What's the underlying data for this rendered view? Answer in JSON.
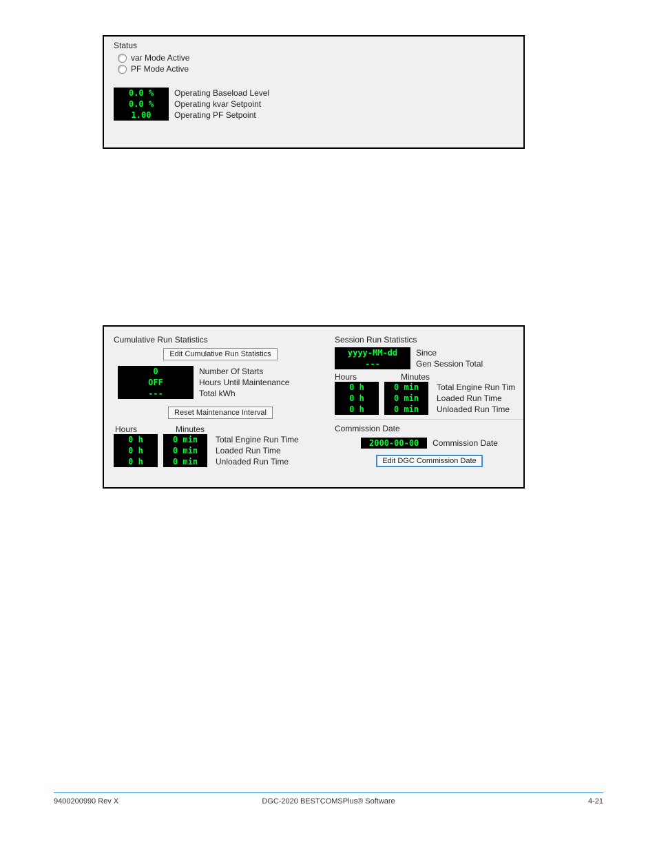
{
  "panel1": {
    "title": "Status",
    "radios": [
      {
        "label": "var Mode Active"
      },
      {
        "label": "PF Mode Active"
      }
    ],
    "readings": [
      {
        "value": "0.0 %",
        "label": "Operating Baseload Level"
      },
      {
        "value": "0.0 %",
        "label": "Operating kvar Setpoint"
      },
      {
        "value": "1.00",
        "label": "Operating PF Setpoint"
      }
    ]
  },
  "panel2": {
    "left": {
      "title": "Cumulative Run Statistics",
      "edit_btn": "Edit Cumulative Run Statistics",
      "stats": [
        {
          "value": "0",
          "label": "Number Of Starts"
        },
        {
          "value": "OFF",
          "label": "Hours Until Maintenance"
        },
        {
          "value": "---",
          "label": "Total kWh"
        }
      ],
      "reset_btn": "Reset Maintenance Interval",
      "hours_hdr": "Hours",
      "minutes_hdr": "Minutes",
      "runs": {
        "hours": [
          "0 h",
          "0 h",
          "0 h"
        ],
        "minutes": [
          "0 min",
          "0 min",
          "0 min"
        ],
        "labels": [
          "Total Engine Run Time",
          "Loaded Run Time",
          "Unloaded Run Time"
        ]
      }
    },
    "right": {
      "title": "Session Run Statistics",
      "since_value": "yyyy-MM-dd",
      "since_label": "Since",
      "dash_value": "---",
      "gen_label": "Gen Session Total",
      "hours_hdr": "Hours",
      "minutes_hdr": "Minutes",
      "runs": {
        "hours": [
          "0 h",
          "0 h",
          "0 h"
        ],
        "minutes": [
          "0 min",
          "0 min",
          "0 min"
        ],
        "labels": [
          "Total Engine Run Tim",
          "Loaded Run Time",
          "Unloaded Run Time"
        ]
      },
      "commission_title": "Commission Date",
      "commission_value": "2000-00-00",
      "commission_label": "Commission Date",
      "commission_btn": "Edit DGC Commission Date"
    }
  },
  "footer": {
    "left": "9400200990 Rev X",
    "center": "DGC-2020 BESTCOMSPlus® Software",
    "right": "4-21"
  }
}
